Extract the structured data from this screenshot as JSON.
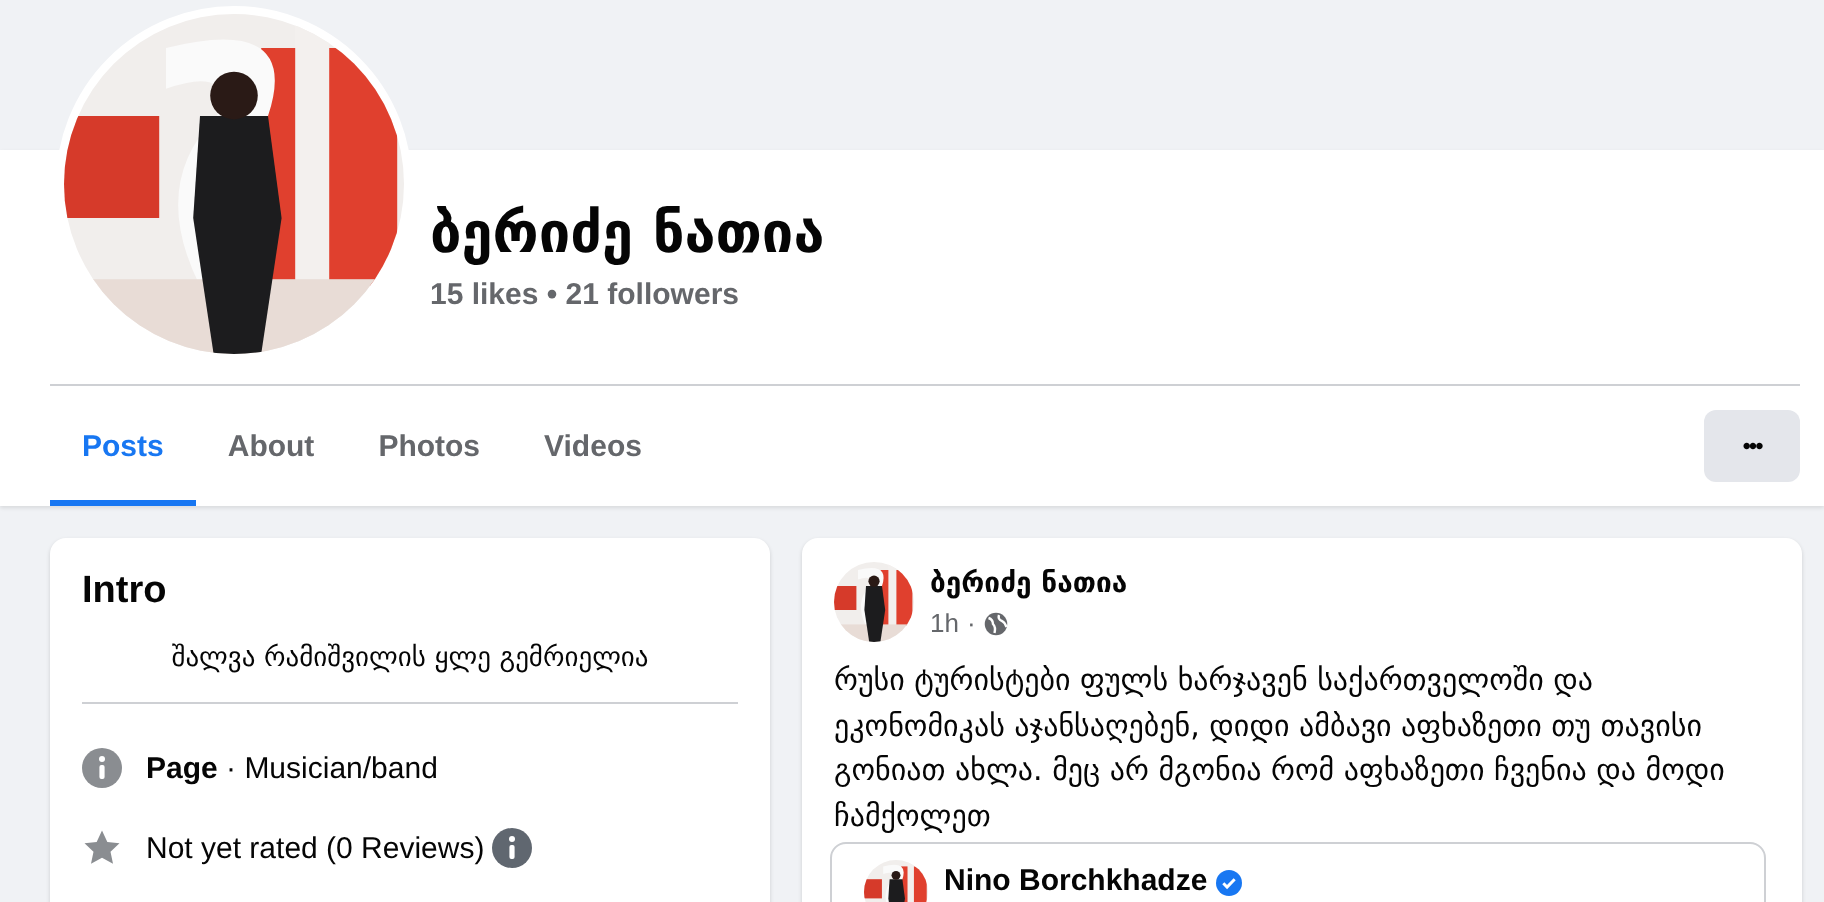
{
  "profile": {
    "name": "ბერიძე ნათია",
    "stats": "15 likes • 21 followers"
  },
  "tabs": [
    {
      "label": "Posts",
      "selected": true
    },
    {
      "label": "About",
      "selected": false
    },
    {
      "label": "Photos",
      "selected": false
    },
    {
      "label": "Videos",
      "selected": false
    }
  ],
  "more_button": {
    "label": "•••"
  },
  "intro": {
    "title": "Intro",
    "bio": "შალვა რამიშვილის ყლე გემრიელია",
    "items": [
      {
        "kind": "info",
        "bold": "Page",
        "text": " · Musician/band"
      },
      {
        "kind": "rating",
        "text": "Not yet rated (0 Reviews)"
      }
    ]
  },
  "post": {
    "author": "ბერიძე ნათია",
    "time": "1h",
    "separator": "·",
    "public": true,
    "text": "რუსი ტურისტები ფულს ხარჯავენ საქართველოში და ეკონომიკას აჯანსაღებენ, დიდი ამბავი აფხაზეთი თუ თავისი გონიათ ახლა. მეც არ მგონია რომ აფხაზეთი ჩვენია და მოდი ჩამქოლეთ",
    "shared": {
      "author": "Nino Borchkhadze",
      "verified": true
    }
  }
}
